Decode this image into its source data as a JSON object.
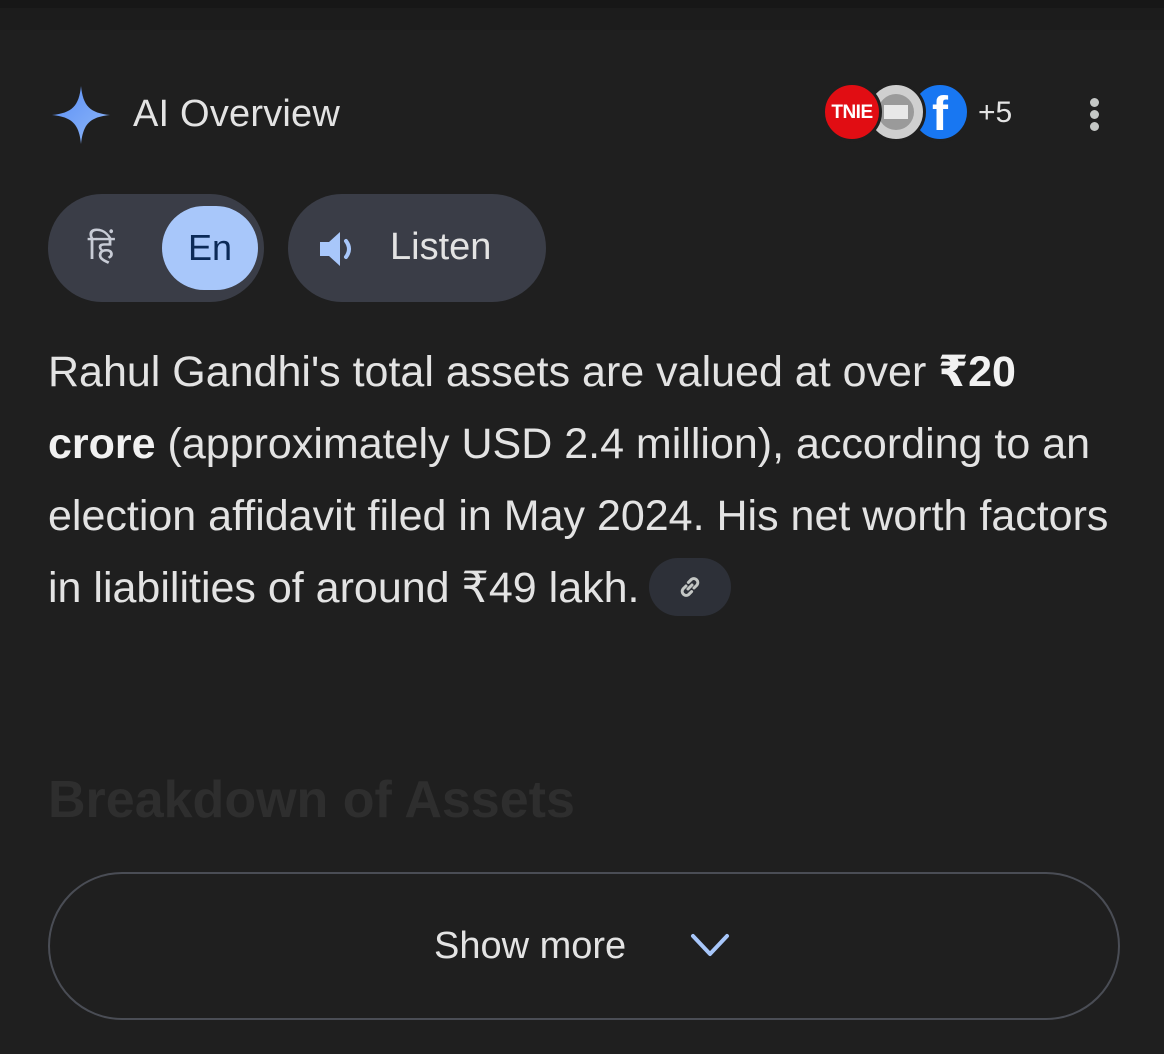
{
  "header": {
    "title": "AI Overview",
    "icon": "sparkle-icon",
    "accent_color": "#8ab4f8"
  },
  "sources": {
    "items": [
      {
        "name": "TNIE",
        "color": "#e10d13"
      },
      {
        "name": "",
        "color": "#cfcfcf"
      },
      {
        "name": "f",
        "color": "#1877f2"
      }
    ],
    "more_count": "+5"
  },
  "language": {
    "hindi_label": "हिं",
    "english_label": "En",
    "selected": "En"
  },
  "listen": {
    "label": "Listen",
    "icon": "speaker-icon"
  },
  "summary": {
    "part1": "Rahul Gandhi's total assets are valued at over ",
    "bold": "₹20 crore",
    "part2": " (approximately USD 2.4 million), according to an election affidavit filed in May 2024. His net worth factors in liabilities of around ₹49 lakh."
  },
  "section_heading": "Breakdown of Assets",
  "show_more": {
    "label": "Show more",
    "icon": "chevron-down-icon"
  }
}
